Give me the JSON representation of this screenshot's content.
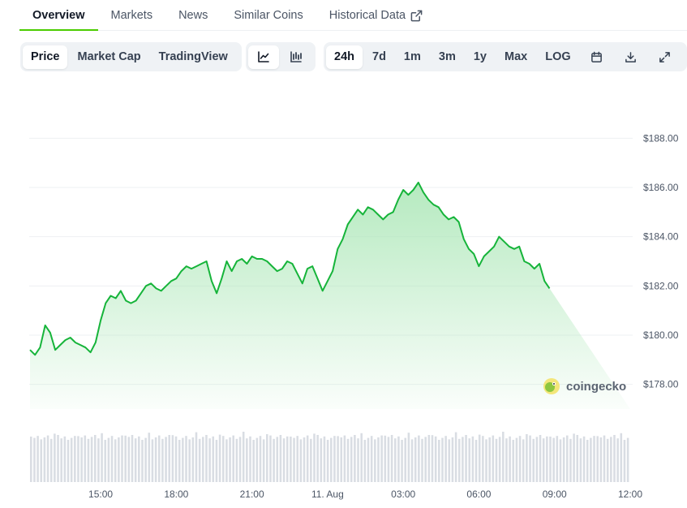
{
  "tabs": [
    {
      "label": "Overview",
      "active": true
    },
    {
      "label": "Markets"
    },
    {
      "label": "News"
    },
    {
      "label": "Similar Coins"
    },
    {
      "label": "Historical Data",
      "icon": "external-link-icon"
    }
  ],
  "chart_type_toggle": {
    "items": [
      "Price",
      "Market Cap",
      "TradingView"
    ],
    "selected": "Price"
  },
  "style_toggle": {
    "items": [
      "line-chart-icon",
      "candlestick-icon"
    ],
    "selected": "line-chart-icon"
  },
  "range_toggle": {
    "items": [
      "24h",
      "7d",
      "1m",
      "3m",
      "1y",
      "Max",
      "LOG"
    ],
    "selected": "24h",
    "icons": [
      "calendar-icon",
      "download-icon",
      "expand-icon"
    ]
  },
  "watermark": "coingecko",
  "colors": {
    "line": "#16b43a",
    "fill_top": "#a8e6b4",
    "volume": "#d9dde3",
    "grid": "#eef0f3",
    "accent": "#4bcc00"
  },
  "chart_data": {
    "type": "area",
    "title": "",
    "xlabel": "",
    "ylabel": "",
    "ylim": [
      177,
      189
    ],
    "y_ticks": [
      "$178.00",
      "$180.00",
      "$182.00",
      "$184.00",
      "$186.00",
      "$188.00"
    ],
    "y_tick_values": [
      178,
      180,
      182,
      184,
      186,
      188
    ],
    "x_ticks": [
      "15:00",
      "18:00",
      "21:00",
      "11. Aug",
      "03:00",
      "06:00",
      "09:00",
      "12:00"
    ],
    "x_range_hours": [
      12.2,
      36
    ],
    "x_tick_hours": [
      15,
      18,
      21,
      24,
      27,
      30,
      33,
      36
    ],
    "grid": true,
    "legend": "none",
    "series": [
      {
        "x_hours": [
          12.2,
          12.4,
          12.6,
          12.8,
          13.0,
          13.2,
          13.4,
          13.6,
          13.8,
          14.0,
          14.2,
          14.4,
          14.6,
          14.8,
          15.0,
          15.2,
          15.4,
          15.6,
          15.8,
          16.0,
          16.2,
          16.4,
          16.6,
          16.8,
          17.0,
          17.2,
          17.4,
          17.6,
          17.8,
          18.0,
          18.2,
          18.4,
          18.6,
          18.8,
          19.0,
          19.2,
          19.4,
          19.6,
          19.8,
          20.0,
          20.2,
          20.4,
          20.6,
          20.8,
          21.0,
          21.2,
          21.4,
          21.6,
          21.8,
          22.0,
          22.2,
          22.4,
          22.6,
          22.8,
          23.0,
          23.2,
          23.4,
          23.6,
          23.8,
          24.0,
          24.2,
          24.4,
          24.6,
          24.8,
          25.0,
          25.2,
          25.4,
          25.6,
          25.8,
          26.0,
          26.2,
          26.4,
          26.6,
          26.8,
          27.0,
          27.2,
          27.4,
          27.6,
          27.8,
          28.0,
          28.2,
          28.4,
          28.6,
          28.8,
          29.0,
          29.2,
          29.4,
          29.6,
          29.8,
          30.0,
          30.2,
          30.4,
          30.6,
          30.8,
          31.0,
          31.2,
          31.4,
          31.6,
          31.8,
          32.0,
          32.2,
          32.4,
          32.6,
          32.8,
          33.0,
          33.2,
          33.4,
          33.6,
          33.8,
          34.0,
          34.2,
          34.4,
          34.6,
          34.8,
          35.0,
          35.2,
          35.4,
          35.6,
          35.8,
          36.0
        ],
        "values": [
          179.4,
          179.2,
          179.5,
          180.4,
          180.1,
          179.4,
          179.6,
          179.8,
          179.9,
          179.7,
          179.6,
          179.5,
          179.3,
          179.7,
          180.6,
          181.3,
          181.6,
          181.5,
          181.8,
          181.4,
          181.3,
          181.4,
          181.7,
          182.0,
          182.1,
          181.9,
          181.8,
          182.0,
          182.2,
          182.3,
          182.6,
          182.8,
          182.7,
          182.8,
          182.9,
          183.0,
          182.2,
          181.7,
          182.3,
          183.0,
          182.6,
          183.0,
          183.1,
          182.9,
          183.2,
          183.1,
          183.1,
          183.0,
          182.8,
          182.6,
          182.7,
          183.0,
          182.9,
          182.5,
          182.1,
          182.7,
          182.8,
          182.3,
          181.8,
          182.2,
          182.6,
          183.5,
          183.9,
          184.5,
          184.8,
          185.1,
          184.9,
          185.2,
          185.1,
          184.9,
          184.7,
          184.9,
          185.0,
          185.5,
          185.9,
          185.7,
          185.9,
          186.2,
          185.8,
          185.5,
          185.3,
          185.2,
          184.9,
          184.7,
          184.8,
          184.6,
          183.9,
          183.5,
          183.3,
          182.8,
          183.2,
          183.4,
          183.6,
          184.0,
          183.8,
          183.6,
          183.5,
          183.6,
          183.0,
          182.9,
          182.7,
          182.9,
          182.2,
          181.9
        ]
      }
    ],
    "volume_bars": 178
  }
}
